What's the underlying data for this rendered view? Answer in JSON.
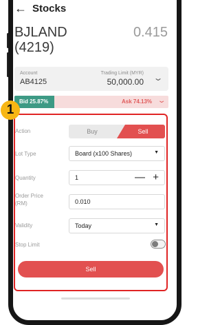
{
  "header": {
    "back_icon": "←",
    "title": "Stocks"
  },
  "stock": {
    "name": "BJLAND",
    "code": "(4219)",
    "price": "0.415"
  },
  "account": {
    "label": "Account",
    "value": "AB4125",
    "limit_label": "Trading Limit (MYR)",
    "limit_value": "50,000.00"
  },
  "depth": {
    "bid_label": "Bid 25.87%",
    "ask_label": "Ask 74.13%",
    "bid_fraction": 0.2587
  },
  "order": {
    "action_label": "Action",
    "buy_label": "Buy",
    "sell_label": "Sell",
    "lot_type_label": "Lot Type",
    "lot_type_value": "Board (x100 Shares)",
    "quantity_label": "Quantity",
    "quantity_value": "1",
    "minus": "—",
    "plus": "+",
    "order_price_label": "Order Price (RM)",
    "order_price_value": "0.010",
    "validity_label": "Validity",
    "validity_value": "Today",
    "stop_limit_label": "Stop Limit",
    "submit_label": "Sell"
  },
  "annotation": {
    "step": "1"
  },
  "colors": {
    "sell": "#e25050",
    "bid": "#3d9a85",
    "highlight": "#e02424",
    "badge": "#f7b614"
  }
}
